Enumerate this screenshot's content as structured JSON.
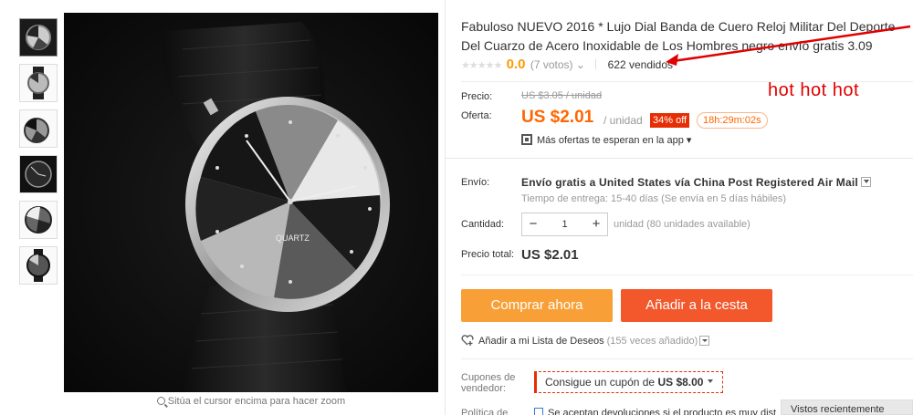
{
  "gallery": {
    "thumbnails": [
      "thumb-1",
      "thumb-2",
      "thumb-3",
      "thumb-4",
      "thumb-5",
      "thumb-6"
    ],
    "zoom_hint": "Sitúa el cursor encima para hacer zoom",
    "watch_brand_text": "QUARTZ"
  },
  "product": {
    "title": "Fabuloso NUEVO 2016 * Lujo Dial Banda de Cuero Reloj Militar Del Deporte Del Cuarzo de Acero Inoxidable de Los Hombres negro envío gratis 3.09",
    "stars": "★★★★★",
    "rating": "0.0",
    "votes": "(7 votos)",
    "votes_caret": "⌄",
    "sold": "622 vendidos"
  },
  "pricing": {
    "price_label": "Precio:",
    "old_price": "US $3.05 / unidad",
    "offer_label": "Oferta:",
    "offer_price": "US $2.01",
    "unit": "/ unidad",
    "discount": "34% off",
    "timer": "18h:29m:02s",
    "app_offers": "Más ofertas te esperan en la app",
    "app_caret": "▾"
  },
  "shipping": {
    "label": "Envío:",
    "method": "Envío gratis a United States vía China Post Registered Air Mail",
    "delivery": "Tiempo de entrega: 15-40 días (Se envía en 5 días hábiles)"
  },
  "quantity": {
    "label": "Cantidad:",
    "minus": "−",
    "value": "1",
    "plus": "+",
    "available": "unidad (80 unidades available)"
  },
  "total": {
    "label": "Precio total:",
    "value": "US $2.01"
  },
  "actions": {
    "buy_now": "Comprar ahora",
    "add_to_cart": "Añadir a la cesta"
  },
  "wishlist": {
    "label": "Añadir a mi Lista de Deseos",
    "count": "(155 veces añadido)"
  },
  "coupon": {
    "label": "Cupones de vendedor:",
    "text": "Consigue un cupón de",
    "amount": "US $8.00"
  },
  "policy": {
    "label": "Política de",
    "text": "Se aceptan devoluciones si el producto es muy dist"
  },
  "recently_viewed": "Vistos recientemente",
  "annotation": {
    "text": "hot hot hot",
    "color": "#e00000"
  },
  "colors": {
    "offer": "#ff6600",
    "buy_button": "#f8a037",
    "cart_button": "#f2582b",
    "discount_badge": "#e62e04",
    "rating": "#ff9900"
  }
}
